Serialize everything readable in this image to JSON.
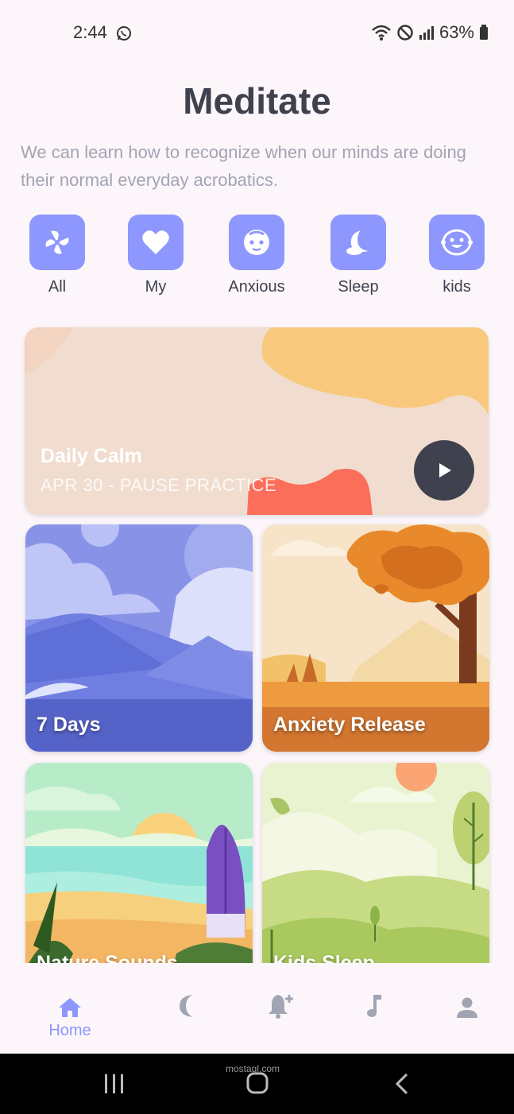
{
  "status": {
    "time": "2:44",
    "battery": "63%"
  },
  "header": {
    "title": "Meditate",
    "subtitle": "We can learn how to recognize when our minds are doing their normal everyday acrobatics."
  },
  "categories": [
    {
      "label": "All",
      "icon": "all-icon"
    },
    {
      "label": "My",
      "icon": "heart-icon"
    },
    {
      "label": "Anxious",
      "icon": "face-icon"
    },
    {
      "label": "Sleep",
      "icon": "moon-icon"
    },
    {
      "label": "kids",
      "icon": "smile-icon"
    }
  ],
  "daily": {
    "title": "Daily Calm",
    "subtitle": "APR 30 - PAUSE PRACTICE"
  },
  "tiles": [
    {
      "label": "7 Days"
    },
    {
      "label": "Anxiety Release"
    },
    {
      "label": "Nature Sounds"
    },
    {
      "label": "Kids Sleep"
    }
  ],
  "nav": {
    "home_label": "Home",
    "items": [
      "home-icon",
      "moon-icon",
      "bell-plus-icon",
      "music-note-icon",
      "person-icon"
    ]
  },
  "colors": {
    "accent": "#8e97fd",
    "text": "#3f414e",
    "subtext": "#a1a4b2",
    "background": "#fcf6fb"
  },
  "watermark": "mostaql.com"
}
